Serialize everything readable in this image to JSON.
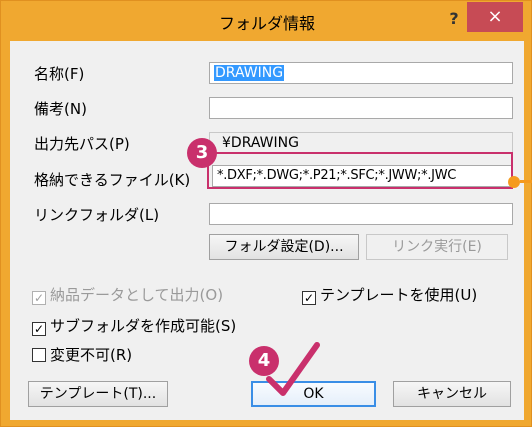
{
  "window": {
    "title": "フォルダ情報",
    "help": "?",
    "close": "×"
  },
  "fields": {
    "name": {
      "label": "名称(F)",
      "value": "DRAWING"
    },
    "remarks": {
      "label": "備考(N)",
      "value": ""
    },
    "output_path": {
      "label": "出力先パス(P)",
      "value": "¥DRAWING"
    },
    "storable_files": {
      "label": "格納できるファイル(K)",
      "value": "*.DXF;*.DWG;*.P21;*.SFC;*.JWW;*.JWC"
    },
    "link_folder": {
      "label": "リンクフォルダ(L)",
      "value": ""
    }
  },
  "buttons": {
    "folder_settings": "フォルダ設定(D)...",
    "link_run": "リンク実行(E)",
    "template": "テンプレート(T)...",
    "ok": "OK",
    "cancel": "キャンセル"
  },
  "checkboxes": {
    "output_as_delivery": {
      "label": "納品データとして出力(O)",
      "checked": true,
      "enabled": false
    },
    "use_template": {
      "label": "テンプレートを使用(U)",
      "checked": true,
      "enabled": true
    },
    "allow_subfolders": {
      "label": "サブフォルダを作成可能(S)",
      "checked": true,
      "enabled": true
    },
    "not_editable": {
      "label": "変更不可(R)",
      "checked": false,
      "enabled": true
    }
  },
  "annotations": {
    "step3": "3",
    "step4": "4",
    "accent_color": "#c9306c",
    "check_mark_color": "#c9306c"
  }
}
